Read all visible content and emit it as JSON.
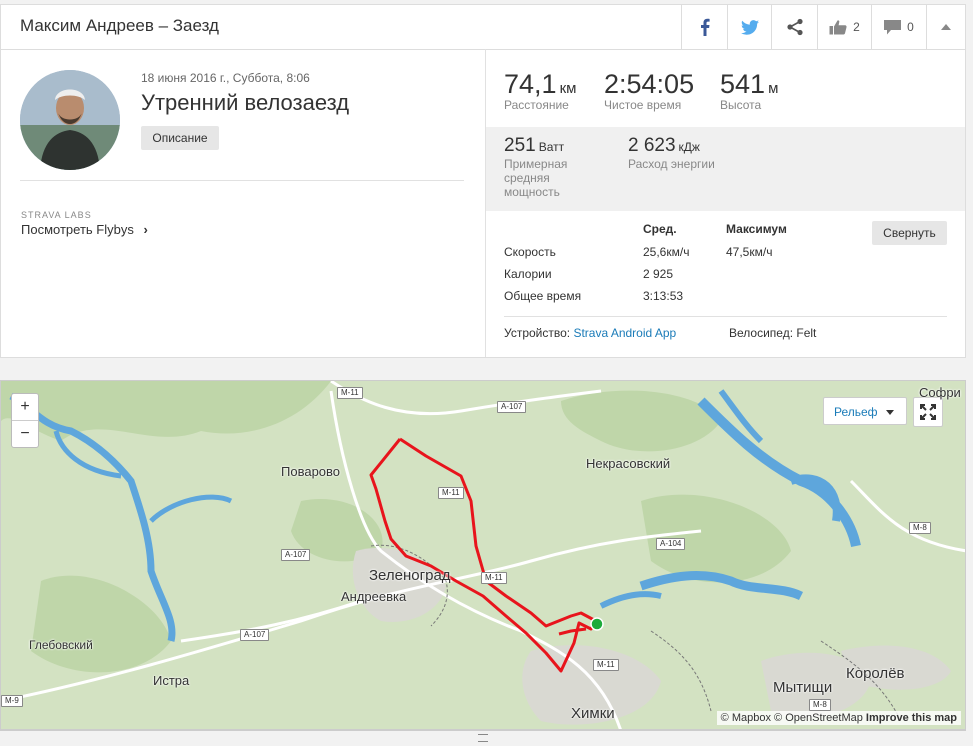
{
  "header": {
    "title": "Максим Андреев – Заезд",
    "kudos_count": "2",
    "comments_count": "0"
  },
  "activity": {
    "date": "18 июня 2016 г., Суббота, 8:06",
    "name": "Утренний велозаезд",
    "description_button": "Описание",
    "labs_label": "STRAVA LABS",
    "flyby_link": "Посмотреть Flybys"
  },
  "stats": {
    "distance": {
      "value": "74,1",
      "unit": "км",
      "label": "Расстояние"
    },
    "moving_time": {
      "value": "2:54:05",
      "unit": "",
      "label": "Чистое время"
    },
    "elevation": {
      "value": "541",
      "unit": "м",
      "label": "Высота"
    },
    "power": {
      "value": "251",
      "unit": "Ватт",
      "label": "Примерная средняя мощность"
    },
    "energy": {
      "value": "2 623",
      "unit": "кДж",
      "label": "Расход энергии"
    }
  },
  "table": {
    "col_avg": "Сред.",
    "col_max": "Максимум",
    "fold_button": "Свернуть",
    "rows": [
      {
        "label": "Скорость",
        "avg": "25,6км/ч",
        "max": "47,5км/ч"
      },
      {
        "label": "Калории",
        "avg": "2 925",
        "max": ""
      },
      {
        "label": "Общее время",
        "avg": "3:13:53",
        "max": ""
      }
    ],
    "device_label": "Устройство:",
    "device_value": "Strava Android App",
    "bike_label": "Велосипед:",
    "bike_value": "Felt"
  },
  "map": {
    "zoom_in": "+",
    "zoom_out": "−",
    "layer": "Рельеф",
    "places": [
      "Поварово",
      "Некрасовский",
      "Зеленоград",
      "Андреевка",
      "Глебовский",
      "Истра",
      "Химки",
      "Мытищи",
      "Королёв",
      "Софри"
    ],
    "roads": [
      "M-11",
      "A-107",
      "M-11",
      "A-104",
      "A-107",
      "M-11",
      "A-107",
      "M-11",
      "M-8",
      "M-9",
      "M-8"
    ],
    "attribution_a": "© Mapbox",
    "attribution_b": "© OpenStreetMap",
    "attribution_c": "Improve this map",
    "route_color": "#e8141c",
    "start_color": "#1dab3b"
  }
}
